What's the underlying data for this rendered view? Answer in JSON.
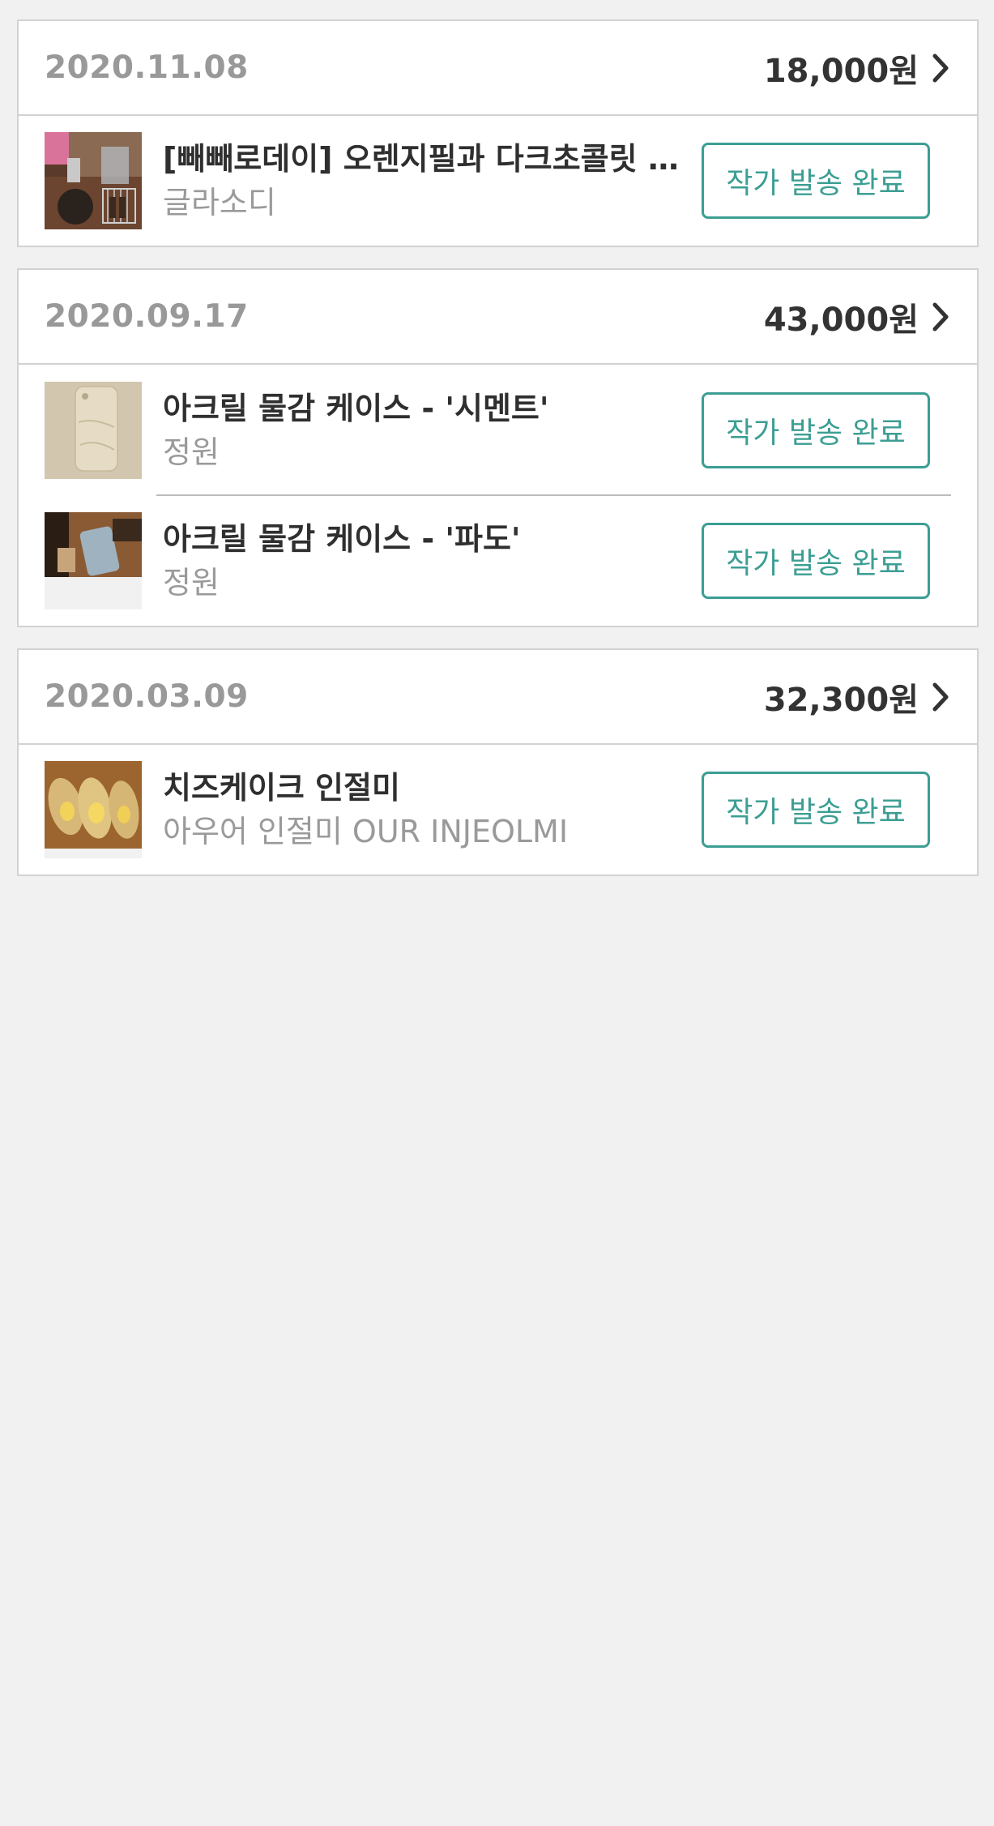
{
  "orders": [
    {
      "date": "2020.11.08",
      "total": "18,000원",
      "items": [
        {
          "title": "[빼빼로데이] 오렌지필과 다크초콜릿 스콘",
          "artist": "글라소디",
          "status": "작가 발송 완료"
        }
      ]
    },
    {
      "date": "2020.09.17",
      "total": "43,000원",
      "items": [
        {
          "title": "아크릴 물감 케이스 - '시멘트'",
          "artist": "정원",
          "status": "작가 발송 완료"
        },
        {
          "title": "아크릴 물감 케이스 - '파도'",
          "artist": "정원",
          "status": "작가 발송 완료"
        }
      ]
    },
    {
      "date": "2020.03.09",
      "total": "32,300원",
      "items": [
        {
          "title": "치즈케이크 인절미",
          "artist": "아우어 인절미 OUR INJEOLMI",
          "status": "작가 발송 완료"
        }
      ]
    }
  ],
  "colors": {
    "background": "#f1f1f1",
    "accent": "#3c9e93",
    "date_text": "#999999",
    "total_text": "#333333"
  }
}
